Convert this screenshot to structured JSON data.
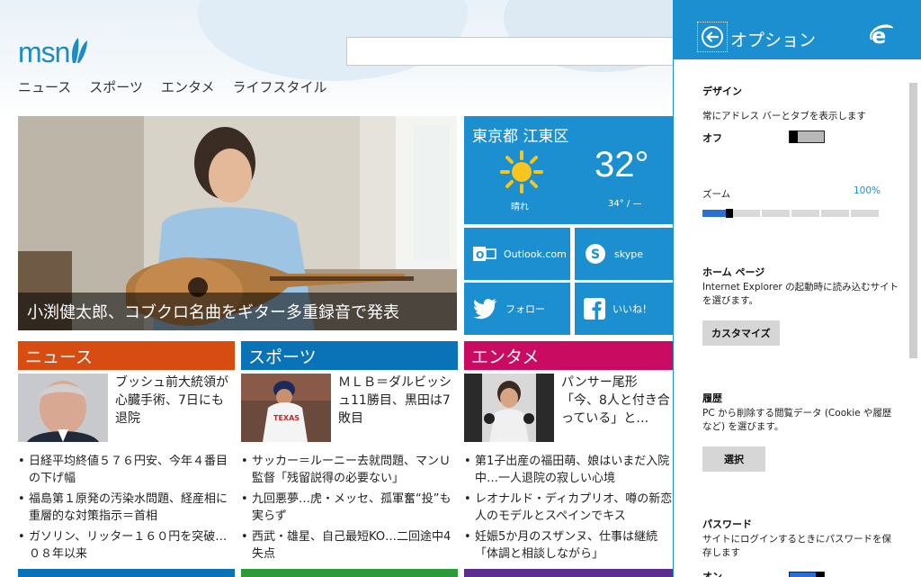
{
  "msn": {
    "logo_text": "msn",
    "nav": [
      "ニュース",
      "スポーツ",
      "エンタメ",
      "ライフスタイル"
    ],
    "hero_caption": "小渕健太郎、コブクロ名曲をギター多重録音で発表",
    "weather": {
      "city": "東京都 江東区",
      "condition": "晴れ",
      "temp": "32°",
      "hilo": "34° / —"
    },
    "tiles": {
      "outlook": "Outlook.com",
      "skype": "skype",
      "twitter": "フォロー",
      "facebook": "いいね！"
    },
    "news": {
      "header": "ニュース",
      "lead": "ブッシュ前大統領が心臓手術、7日にも退院",
      "items": [
        "日経平均終値５７６円安、今年４番目の下げ幅",
        "福島第１原発の汚染水問題、経産相に重層的な対策指示＝首相",
        "ガソリン、リッター１６０円を突破…０８年以来"
      ]
    },
    "sports": {
      "header": "スポーツ",
      "lead": "ＭＬＢ＝ダルビッシュ11勝目、黒田は7敗目",
      "items": [
        "サッカー＝ルーニー去就問題、マンＵ監督「残留説得の必要ない」",
        "九回悪夢…虎・メッセ、孤軍奮“投”も実らず",
        "西武・雄星、自己最短KO…二回途中4失点"
      ]
    },
    "entertainment": {
      "header": "エンタメ",
      "lead": "パンサー尾形「今、8人と付き合っている」と…",
      "items": [
        "第1子出産の福田萌、娘はいまだ入院中…一人退院の寂しい心境",
        "レオナルド・ディカプリオ、噂の新恋人のモデルとスペインでキス",
        "妊娠5か月のスザンヌ、仕事は継続「体調と相談しながら」"
      ]
    },
    "colors": {
      "news": "#d74c10",
      "sports": "#0a73b8",
      "entertainment": "#c90b61",
      "tile": "#1b8fcf"
    }
  },
  "options": {
    "title": "オプション",
    "design": {
      "title": "デザイン",
      "always_show_label": "常にアドレス バーとタブを表示します",
      "toggle_state": "オフ",
      "zoom_label": "ズーム",
      "zoom_value": "100%"
    },
    "home": {
      "title": "ホーム ページ",
      "text": "Internet Explorer の起動時に読み込むサイトを選びます。",
      "button": "カスタマイズ"
    },
    "history": {
      "title": "履歴",
      "text": "PC から削除する閲覧データ (Cookie や履歴など) を選びます。",
      "button": "選択"
    },
    "passwords": {
      "title": "パスワード",
      "text": "サイトにログインするときにパスワードを保存します",
      "toggle_state": "オン"
    }
  }
}
